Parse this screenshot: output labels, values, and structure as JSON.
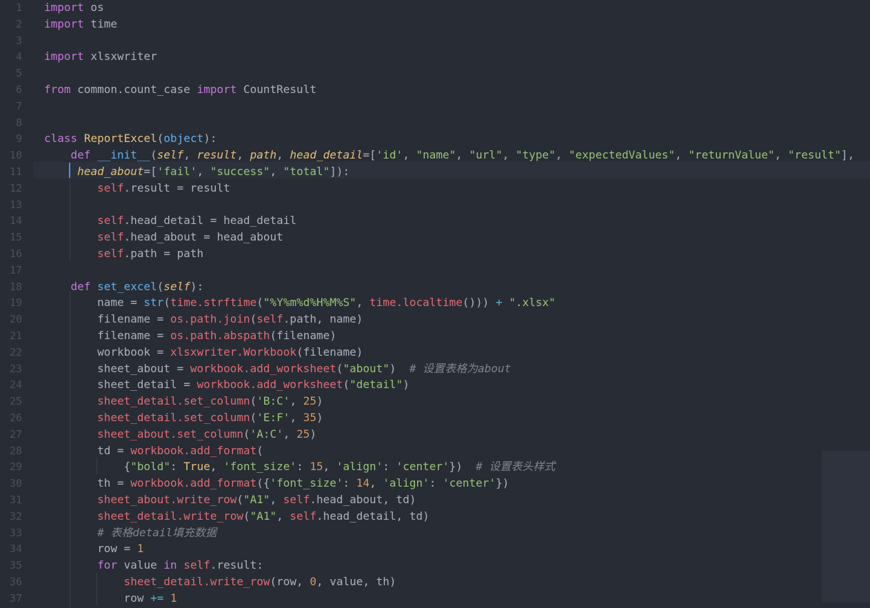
{
  "lines": [
    {
      "n": "1",
      "tokens": [
        {
          "c": "kw",
          "t": "import"
        },
        {
          "c": "plain",
          "t": " os"
        }
      ]
    },
    {
      "n": "2",
      "tokens": [
        {
          "c": "kw",
          "t": "import"
        },
        {
          "c": "plain",
          "t": " time"
        }
      ]
    },
    {
      "n": "3",
      "tokens": []
    },
    {
      "n": "4",
      "tokens": [
        {
          "c": "kw",
          "t": "import"
        },
        {
          "c": "plain",
          "t": " xlsxwriter"
        }
      ]
    },
    {
      "n": "5",
      "tokens": []
    },
    {
      "n": "6",
      "tokens": [
        {
          "c": "kw",
          "t": "from"
        },
        {
          "c": "plain",
          "t": " common.count_case "
        },
        {
          "c": "kw",
          "t": "import"
        },
        {
          "c": "plain",
          "t": " CountResult"
        }
      ]
    },
    {
      "n": "7",
      "tokens": []
    },
    {
      "n": "8",
      "tokens": []
    },
    {
      "n": "9",
      "tokens": [
        {
          "c": "kw",
          "t": "class"
        },
        {
          "c": "plain",
          "t": " "
        },
        {
          "c": "cls",
          "t": "ReportExcel"
        },
        {
          "c": "plain",
          "t": "("
        },
        {
          "c": "fn",
          "t": "object"
        },
        {
          "c": "plain",
          "t": "):"
        }
      ]
    },
    {
      "n": "10",
      "tokens": [
        {
          "c": "plain",
          "t": "    "
        },
        {
          "c": "kw",
          "t": "def"
        },
        {
          "c": "plain",
          "t": " "
        },
        {
          "c": "fn",
          "t": "__init__"
        },
        {
          "c": "plain",
          "t": "("
        },
        {
          "c": "param",
          "t": "self"
        },
        {
          "c": "plain",
          "t": ", "
        },
        {
          "c": "param",
          "t": "result"
        },
        {
          "c": "plain",
          "t": ", "
        },
        {
          "c": "param",
          "t": "path"
        },
        {
          "c": "plain",
          "t": ", "
        },
        {
          "c": "param",
          "t": "head_detail"
        },
        {
          "c": "plain",
          "t": "=["
        },
        {
          "c": "str",
          "t": "'id'"
        },
        {
          "c": "plain",
          "t": ", "
        },
        {
          "c": "str",
          "t": "\"name\""
        },
        {
          "c": "plain",
          "t": ", "
        },
        {
          "c": "str",
          "t": "\"url\""
        },
        {
          "c": "plain",
          "t": ", "
        },
        {
          "c": "str",
          "t": "\"type\""
        },
        {
          "c": "plain",
          "t": ", "
        },
        {
          "c": "str",
          "t": "\"expectedValues\""
        },
        {
          "c": "plain",
          "t": ", "
        },
        {
          "c": "str",
          "t": "\"returnValue\""
        },
        {
          "c": "plain",
          "t": ", "
        },
        {
          "c": "str",
          "t": "\"result\""
        },
        {
          "c": "plain",
          "t": "],"
        }
      ]
    },
    {
      "n": "11",
      "tokens": [
        {
          "c": "plain",
          "t": "     "
        },
        {
          "c": "param",
          "t": "head_about"
        },
        {
          "c": "plain",
          "t": "=["
        },
        {
          "c": "str",
          "t": "'fail'"
        },
        {
          "c": "plain",
          "t": ", "
        },
        {
          "c": "str",
          "t": "\"success\""
        },
        {
          "c": "plain",
          "t": ", "
        },
        {
          "c": "str",
          "t": "\"total\""
        },
        {
          "c": "plain",
          "t": "]):"
        }
      ]
    },
    {
      "n": "12",
      "tokens": [
        {
          "c": "plain",
          "t": "        "
        },
        {
          "c": "self",
          "t": "self"
        },
        {
          "c": "plain",
          "t": ".result = result"
        }
      ]
    },
    {
      "n": "13",
      "tokens": []
    },
    {
      "n": "14",
      "tokens": [
        {
          "c": "plain",
          "t": "        "
        },
        {
          "c": "self",
          "t": "self"
        },
        {
          "c": "plain",
          "t": ".head_detail = head_detail"
        }
      ]
    },
    {
      "n": "15",
      "tokens": [
        {
          "c": "plain",
          "t": "        "
        },
        {
          "c": "self",
          "t": "self"
        },
        {
          "c": "plain",
          "t": ".head_about = head_about"
        }
      ]
    },
    {
      "n": "16",
      "tokens": [
        {
          "c": "plain",
          "t": "        "
        },
        {
          "c": "self",
          "t": "self"
        },
        {
          "c": "plain",
          "t": ".path = path"
        }
      ]
    },
    {
      "n": "17",
      "tokens": []
    },
    {
      "n": "18",
      "tokens": [
        {
          "c": "plain",
          "t": "    "
        },
        {
          "c": "kw",
          "t": "def"
        },
        {
          "c": "plain",
          "t": " "
        },
        {
          "c": "fn",
          "t": "set_excel"
        },
        {
          "c": "plain",
          "t": "("
        },
        {
          "c": "param",
          "t": "self"
        },
        {
          "c": "plain",
          "t": "):"
        }
      ]
    },
    {
      "n": "19",
      "tokens": [
        {
          "c": "plain",
          "t": "        name = "
        },
        {
          "c": "fn",
          "t": "str"
        },
        {
          "c": "plain",
          "t": "("
        },
        {
          "c": "meth",
          "t": "time.strftime"
        },
        {
          "c": "plain",
          "t": "("
        },
        {
          "c": "str",
          "t": "\"%Y%m%d%H%M%S\""
        },
        {
          "c": "plain",
          "t": ", "
        },
        {
          "c": "meth",
          "t": "time.localtime"
        },
        {
          "c": "plain",
          "t": "())) "
        },
        {
          "c": "op",
          "t": "+"
        },
        {
          "c": "plain",
          "t": " "
        },
        {
          "c": "str",
          "t": "\".xlsx\""
        }
      ]
    },
    {
      "n": "20",
      "tokens": [
        {
          "c": "plain",
          "t": "        filename = "
        },
        {
          "c": "meth",
          "t": "os.path.join"
        },
        {
          "c": "plain",
          "t": "("
        },
        {
          "c": "self",
          "t": "self"
        },
        {
          "c": "plain",
          "t": ".path, name)"
        }
      ]
    },
    {
      "n": "21",
      "tokens": [
        {
          "c": "plain",
          "t": "        filename = "
        },
        {
          "c": "meth",
          "t": "os.path.abspath"
        },
        {
          "c": "plain",
          "t": "(filename)"
        }
      ]
    },
    {
      "n": "22",
      "tokens": [
        {
          "c": "plain",
          "t": "        workbook = "
        },
        {
          "c": "meth",
          "t": "xlsxwriter.Workbook"
        },
        {
          "c": "plain",
          "t": "(filename)"
        }
      ]
    },
    {
      "n": "23",
      "tokens": [
        {
          "c": "plain",
          "t": "        sheet_about = "
        },
        {
          "c": "meth",
          "t": "workbook.add_worksheet"
        },
        {
          "c": "plain",
          "t": "("
        },
        {
          "c": "str",
          "t": "\"about\""
        },
        {
          "c": "plain",
          "t": ")  "
        },
        {
          "c": "cmt",
          "t": "# 设置表格为about"
        }
      ]
    },
    {
      "n": "24",
      "tokens": [
        {
          "c": "plain",
          "t": "        sheet_detail = "
        },
        {
          "c": "meth",
          "t": "workbook.add_worksheet"
        },
        {
          "c": "plain",
          "t": "("
        },
        {
          "c": "str",
          "t": "\"detail\""
        },
        {
          "c": "plain",
          "t": ")"
        }
      ]
    },
    {
      "n": "25",
      "tokens": [
        {
          "c": "plain",
          "t": "        "
        },
        {
          "c": "meth",
          "t": "sheet_detail.set_column"
        },
        {
          "c": "plain",
          "t": "("
        },
        {
          "c": "str",
          "t": "'B:C'"
        },
        {
          "c": "plain",
          "t": ", "
        },
        {
          "c": "num",
          "t": "25"
        },
        {
          "c": "plain",
          "t": ")"
        }
      ]
    },
    {
      "n": "26",
      "tokens": [
        {
          "c": "plain",
          "t": "        "
        },
        {
          "c": "meth",
          "t": "sheet_detail.set_column"
        },
        {
          "c": "plain",
          "t": "("
        },
        {
          "c": "str",
          "t": "'E:F'"
        },
        {
          "c": "plain",
          "t": ", "
        },
        {
          "c": "num",
          "t": "35"
        },
        {
          "c": "plain",
          "t": ")"
        }
      ]
    },
    {
      "n": "27",
      "tokens": [
        {
          "c": "plain",
          "t": "        "
        },
        {
          "c": "meth",
          "t": "sheet_about.set_column"
        },
        {
          "c": "plain",
          "t": "("
        },
        {
          "c": "str",
          "t": "'A:C'"
        },
        {
          "c": "plain",
          "t": ", "
        },
        {
          "c": "num",
          "t": "25"
        },
        {
          "c": "plain",
          "t": ")"
        }
      ]
    },
    {
      "n": "28",
      "tokens": [
        {
          "c": "plain",
          "t": "        td = "
        },
        {
          "c": "meth",
          "t": "workbook.add_format"
        },
        {
          "c": "plain",
          "t": "("
        }
      ]
    },
    {
      "n": "29",
      "tokens": [
        {
          "c": "plain",
          "t": "            {"
        },
        {
          "c": "str",
          "t": "\"bold\""
        },
        {
          "c": "plain",
          "t": ": "
        },
        {
          "c": "cls",
          "t": "True"
        },
        {
          "c": "plain",
          "t": ", "
        },
        {
          "c": "str",
          "t": "'font_size'"
        },
        {
          "c": "plain",
          "t": ": "
        },
        {
          "c": "num",
          "t": "15"
        },
        {
          "c": "plain",
          "t": ", "
        },
        {
          "c": "str",
          "t": "'align'"
        },
        {
          "c": "plain",
          "t": ": "
        },
        {
          "c": "str",
          "t": "'center'"
        },
        {
          "c": "plain",
          "t": "})  "
        },
        {
          "c": "cmt",
          "t": "# 设置表头样式"
        }
      ]
    },
    {
      "n": "30",
      "tokens": [
        {
          "c": "plain",
          "t": "        th = "
        },
        {
          "c": "meth",
          "t": "workbook.add_format"
        },
        {
          "c": "plain",
          "t": "({"
        },
        {
          "c": "str",
          "t": "'font_size'"
        },
        {
          "c": "plain",
          "t": ": "
        },
        {
          "c": "num",
          "t": "14"
        },
        {
          "c": "plain",
          "t": ", "
        },
        {
          "c": "str",
          "t": "'align'"
        },
        {
          "c": "plain",
          "t": ": "
        },
        {
          "c": "str",
          "t": "'center'"
        },
        {
          "c": "plain",
          "t": "})"
        }
      ]
    },
    {
      "n": "31",
      "tokens": [
        {
          "c": "plain",
          "t": "        "
        },
        {
          "c": "meth",
          "t": "sheet_about.write_row"
        },
        {
          "c": "plain",
          "t": "("
        },
        {
          "c": "str",
          "t": "\"A1\""
        },
        {
          "c": "plain",
          "t": ", "
        },
        {
          "c": "self",
          "t": "self"
        },
        {
          "c": "plain",
          "t": ".head_about, td)"
        }
      ]
    },
    {
      "n": "32",
      "tokens": [
        {
          "c": "plain",
          "t": "        "
        },
        {
          "c": "meth",
          "t": "sheet_detail.write_row"
        },
        {
          "c": "plain",
          "t": "("
        },
        {
          "c": "str",
          "t": "\"A1\""
        },
        {
          "c": "plain",
          "t": ", "
        },
        {
          "c": "self",
          "t": "self"
        },
        {
          "c": "plain",
          "t": ".head_detail, td)"
        }
      ]
    },
    {
      "n": "33",
      "tokens": [
        {
          "c": "plain",
          "t": "        "
        },
        {
          "c": "cmt",
          "t": "# 表格detail填充数据"
        }
      ]
    },
    {
      "n": "34",
      "tokens": [
        {
          "c": "plain",
          "t": "        row = "
        },
        {
          "c": "num",
          "t": "1"
        }
      ]
    },
    {
      "n": "35",
      "tokens": [
        {
          "c": "plain",
          "t": "        "
        },
        {
          "c": "kw",
          "t": "for"
        },
        {
          "c": "plain",
          "t": " value "
        },
        {
          "c": "kw",
          "t": "in"
        },
        {
          "c": "plain",
          "t": " "
        },
        {
          "c": "self",
          "t": "self"
        },
        {
          "c": "plain",
          "t": ".result:"
        }
      ]
    },
    {
      "n": "36",
      "tokens": [
        {
          "c": "plain",
          "t": "            "
        },
        {
          "c": "meth",
          "t": "sheet_detail.write_row"
        },
        {
          "c": "plain",
          "t": "(row, "
        },
        {
          "c": "num",
          "t": "0"
        },
        {
          "c": "plain",
          "t": ", value, th)"
        }
      ]
    },
    {
      "n": "37",
      "tokens": [
        {
          "c": "plain",
          "t": "            row "
        },
        {
          "c": "op",
          "t": "+="
        },
        {
          "c": "plain",
          "t": " "
        },
        {
          "c": "num",
          "t": "1"
        }
      ]
    }
  ],
  "colors": {
    "background": "#282c34",
    "keyword": "#c678dd",
    "class_name": "#e5c07b",
    "function": "#61afef",
    "self": "#e06c75",
    "string": "#98c379",
    "number": "#d19a66",
    "comment": "#7f848e",
    "line_number": "#495162"
  }
}
